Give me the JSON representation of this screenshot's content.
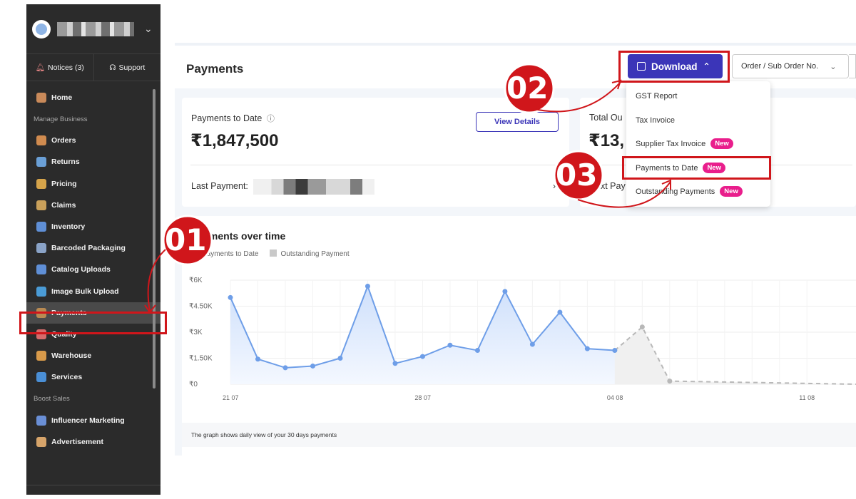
{
  "sidebar": {
    "notices_label": "Notices (3)",
    "support_label": "Support",
    "sections": {
      "manage_business": "Manage Business",
      "boost_sales": "Boost Sales"
    },
    "items": [
      {
        "label": "Home",
        "icon": "home-icon",
        "color": "#c98a5a"
      },
      {
        "label": "Orders",
        "icon": "orders-icon",
        "color": "#d08b4f"
      },
      {
        "label": "Returns",
        "icon": "returns-icon",
        "color": "#6a9fd6"
      },
      {
        "label": "Pricing",
        "icon": "pricing-icon",
        "color": "#d6a44a"
      },
      {
        "label": "Claims",
        "icon": "claims-icon",
        "color": "#c9a05a"
      },
      {
        "label": "Inventory",
        "icon": "inventory-icon",
        "color": "#5f8fd6"
      },
      {
        "label": "Barcoded Packaging",
        "icon": "barcode-icon",
        "color": "#8aa3c7"
      },
      {
        "label": "Catalog Uploads",
        "icon": "catalog-icon",
        "color": "#5f8fd6"
      },
      {
        "label": "Image Bulk Upload",
        "icon": "image-upload-icon",
        "color": "#4a9bd6"
      },
      {
        "label": "Payments",
        "icon": "payments-icon",
        "color": "#b88a52"
      },
      {
        "label": "Quality",
        "icon": "quality-icon",
        "color": "#d66a6a"
      },
      {
        "label": "Warehouse",
        "icon": "warehouse-icon",
        "color": "#d89a4a"
      },
      {
        "label": "Services",
        "icon": "services-icon",
        "color": "#4a8fd6"
      },
      {
        "label": "Influencer Marketing",
        "icon": "influencer-icon",
        "color": "#6a8fd6"
      },
      {
        "label": "Advertisement",
        "icon": "megaphone-icon",
        "color": "#d6a46a"
      }
    ]
  },
  "header": {
    "title": "Payments",
    "download_label": "Download",
    "order_select_label": "Order / Sub Order No."
  },
  "cards": {
    "payments_to_date_label": "Payments to Date",
    "payments_to_date_value": "₹1,847,500",
    "view_details_label": "View Details",
    "last_payment_label": "Last Payment:",
    "total_outstanding_label_partial": "Total Ou",
    "total_outstanding_value_partial": "₹13,",
    "next_payment_label_partial": "Next Pay"
  },
  "dropdown": {
    "items": [
      {
        "label": "GST Report",
        "badge": ""
      },
      {
        "label": "Tax Invoice",
        "badge": ""
      },
      {
        "label": "Supplier Tax Invoice",
        "badge": "New"
      },
      {
        "label": "Payments to Date",
        "badge": "New"
      },
      {
        "label": "Outstanding Payments",
        "badge": "New"
      }
    ]
  },
  "graph": {
    "title": "Payments over time",
    "footer": "The graph shows daily view of your 30 days payments"
  },
  "annotations": [
    "01",
    "02",
    "03"
  ],
  "chart_data": {
    "type": "line",
    "title": "Payments over time",
    "xlabel": "",
    "ylabel": "",
    "ylim": [
      0,
      6000
    ],
    "ytick_labels": [
      "₹0",
      "₹1.50K",
      "₹3K",
      "₹4.50K",
      "₹6K"
    ],
    "yticks": [
      0,
      1500,
      3000,
      4500,
      6000
    ],
    "xtick_labels": [
      "21 07",
      "28 07",
      "04 08",
      "11 08"
    ],
    "xtick_index": [
      0,
      7,
      14,
      21
    ],
    "series": [
      {
        "name": "Payments to Date",
        "color": "#6e9ee8",
        "x": [
          0,
          1,
          2,
          3,
          4,
          5,
          6,
          7,
          8,
          9,
          10,
          11,
          12,
          13,
          14,
          15,
          16,
          17,
          18,
          19,
          20,
          21
        ],
        "values": [
          5000,
          1450,
          950,
          1050,
          1500,
          5650,
          1200,
          1600,
          2250,
          1950,
          5350,
          2300,
          4150,
          2050,
          1950,
          null,
          null,
          null,
          null,
          null,
          null,
          null
        ]
      },
      {
        "name": "Outstanding Payment",
        "color": "#b8b8b8",
        "x": [
          14,
          15,
          16
        ],
        "values": [
          1950,
          3300,
          180
        ]
      }
    ],
    "legend": "top-left",
    "grid": true
  }
}
